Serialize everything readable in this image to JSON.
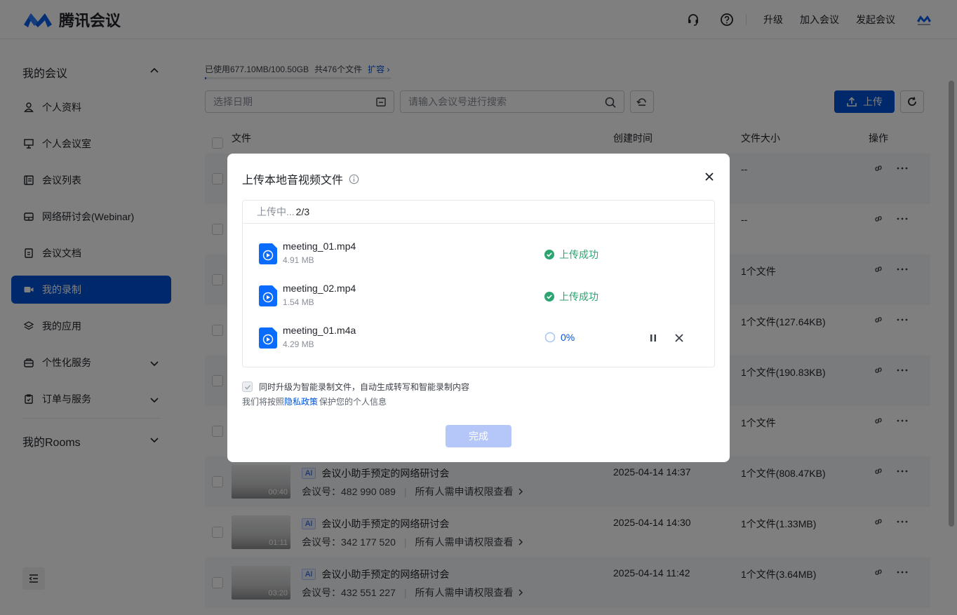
{
  "header": {
    "app_name": "腾讯会议",
    "links": [
      "升级",
      "加入会议",
      "发起会议"
    ]
  },
  "sidebar": {
    "section_my_meetings": "我的会议",
    "items": [
      {
        "label": "个人资料"
      },
      {
        "label": "个人会议室"
      },
      {
        "label": "会议列表"
      },
      {
        "label": "网络研讨会(Webinar)"
      },
      {
        "label": "会议文档"
      },
      {
        "label": "我的录制",
        "active": true
      },
      {
        "label": "我的应用"
      },
      {
        "label": "个性化服务"
      },
      {
        "label": "订单与服务"
      }
    ],
    "section_rooms": "我的Rooms"
  },
  "main": {
    "storage_text": "已使用677.10MB/100.50GB",
    "file_count": "共476个文件",
    "expand_label": "扩容",
    "storage_used_fraction": 0.0066,
    "date_placeholder": "选择日期",
    "search_placeholder": "请输入会议号进行搜索",
    "upload_label": "上传",
    "columns": {
      "file": "文件",
      "created": "创建时间",
      "size": "文件大小",
      "actions": "操作"
    },
    "rows": [
      {
        "size": "--"
      },
      {
        "size": "--"
      },
      {
        "size": "1个文件"
      },
      {
        "size": "1个文件(127.64KB)"
      },
      {
        "size": "1个文件(190.83KB)"
      },
      {
        "size": "1个文件"
      },
      {
        "duration": "00:40",
        "ai": "AI",
        "title": "会议小助手预定的网络研讨会",
        "meeting_id": "会议号：482 990 089",
        "permission": "所有人需申请权限查看",
        "time": "2025-04-14 14:37",
        "size": "1个文件(808.47KB)"
      },
      {
        "duration": "01:11",
        "ai": "AI",
        "title": "会议小助手预定的网络研讨会",
        "meeting_id": "会议号：342 177 520",
        "permission": "所有人需申请权限查看",
        "time": "2025-04-14 14:30",
        "size": "1个文件(1.33MB)"
      },
      {
        "duration": "03:20",
        "ai": "AI",
        "title": "会议小助手预定的网络研讨会",
        "meeting_id": "会议号：432 551 227",
        "permission": "所有人需申请权限查看",
        "time": "2025-04-14 11:42",
        "size": "1个文件(3.64MB)"
      }
    ]
  },
  "modal": {
    "title": "上传本地音视频文件",
    "progress_label": "上传中...",
    "progress_count": "2/3",
    "files": [
      {
        "name": "meeting_01.mp4",
        "size": "4.91 MB",
        "status": "上传成功"
      },
      {
        "name": "meeting_02.mp4",
        "size": "1.54 MB",
        "status": "上传成功"
      },
      {
        "name": "meeting_01.m4a",
        "size": "4.29 MB",
        "status": "0%"
      }
    ],
    "option_text": "同时升级为智能录制文件，自动生成转写和智能录制内容",
    "privacy_prefix": "我们将按照",
    "privacy_link": "隐私政策",
    "privacy_suffix": "保护您的个人信息",
    "done_label": "完成"
  },
  "colors": {
    "brand": "#0052d9",
    "success": "#2ba471",
    "overlay": "rgba(0,0,0,0.5)"
  }
}
